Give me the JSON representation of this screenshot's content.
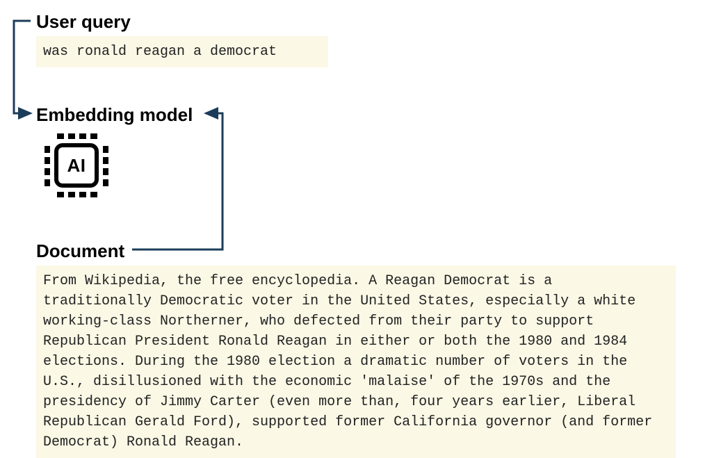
{
  "colors": {
    "highlight_bg": "#fbf8e6",
    "connector": "#1c3d5a"
  },
  "query": {
    "heading": "User query",
    "text": "was ronald reagan a democrat"
  },
  "embedding": {
    "heading": "Embedding model",
    "chip_label": "AI"
  },
  "document": {
    "heading": "Document",
    "text": "From Wikipedia, the free encyclopedia. A Reagan Democrat is a traditionally Democratic voter in the United States, especially a white working-class Northerner, who defected from their party to support Republican President Ronald Reagan in either or both the 1980 and 1984 elections. During the 1980 election a dramatic number of voters in the U.S., disillusioned with the economic 'malaise' of the 1970s and the presidency of Jimmy Carter (even more than, four years earlier, Liberal Republican Gerald Ford), supported former California governor (and former Democrat) Ronald Reagan."
  }
}
